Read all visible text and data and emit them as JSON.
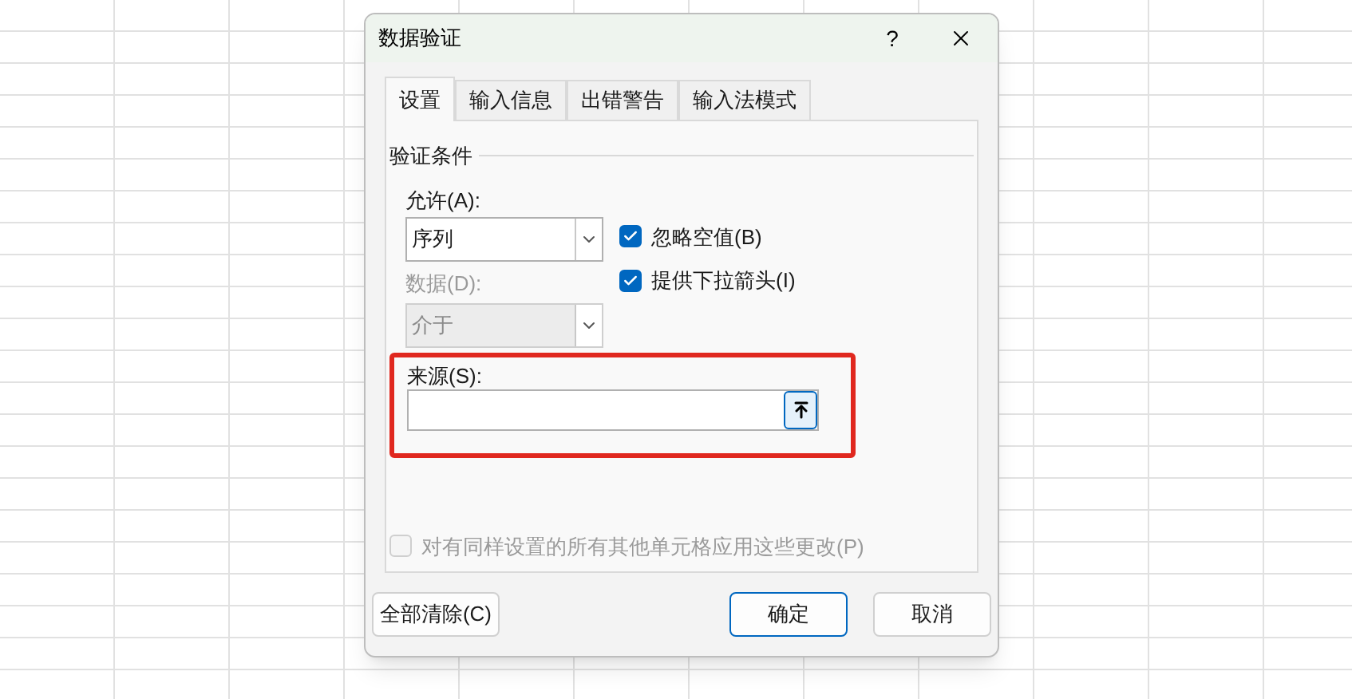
{
  "dialog": {
    "title": "数据验证",
    "help": "?"
  },
  "tabs": [
    {
      "label": "设置",
      "selected": true
    },
    {
      "label": "输入信息",
      "selected": false
    },
    {
      "label": "出错警告",
      "selected": false
    },
    {
      "label": "输入法模式",
      "selected": false
    }
  ],
  "group_title": "验证条件",
  "allow": {
    "label": "允许(A):",
    "value": "序列",
    "disabled": false
  },
  "data": {
    "label": "数据(D):",
    "value": "介于",
    "disabled": true
  },
  "options": [
    {
      "label": "忽略空值(B)",
      "checked": true,
      "disabled": false
    },
    {
      "label": "提供下拉箭头(I)",
      "checked": true,
      "disabled": false
    }
  ],
  "source": {
    "label": "来源(S):",
    "highlighted": true
  },
  "apply_all": {
    "label": "对有同样设置的所有其他单元格应用这些更改(P)",
    "checked": false,
    "disabled": true
  },
  "buttons": [
    {
      "label": "全部清除(C)",
      "kind": "secondary"
    },
    {
      "label": "确定",
      "kind": "primary"
    },
    {
      "label": "取消",
      "kind": "secondary"
    }
  ]
}
